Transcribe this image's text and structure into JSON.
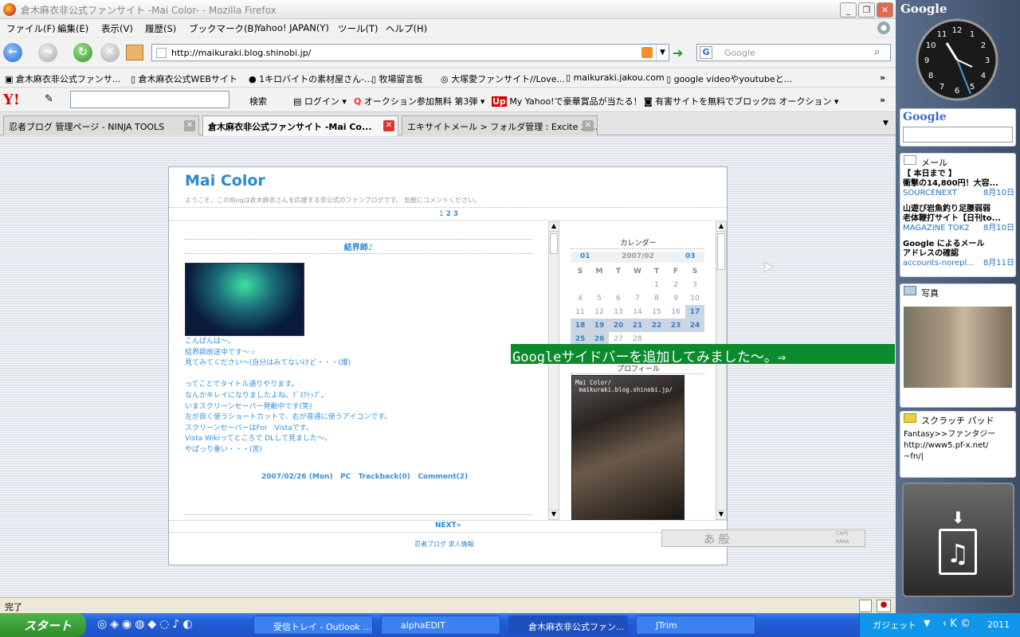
{
  "window": {
    "title": "倉木麻衣非公式ファンサイト -Mai Color- - Mozilla Firefox"
  },
  "menu": [
    "ファイル(F)",
    "編集(E)",
    "表示(V)",
    "履歴(S)",
    "ブックマーク(B)",
    "Yahoo! JAPAN(Y)",
    "ツール(T)",
    "ヘルプ(H)"
  ],
  "nav": {
    "url": "http://maikuraki.blog.shinobi.jp/",
    "search_placeholder": "Google"
  },
  "bookmarks": [
    "倉木麻衣非公式ファンサ...",
    "倉木麻衣公式WEBサイト",
    "1キロバイトの素材屋さん-...",
    "牧場留言板",
    "大塚愛ファンサイト//Love...",
    "maikuraki.jakou.com",
    "google videoやyoutubeと..."
  ],
  "yahoo_toolbar": {
    "search": "検索",
    "login": "ログイン",
    "items": [
      "オークション参加無料 第3弾",
      "My Yahoo!で豪華賞品が当たる！",
      "有害サイトを無料でブロック",
      "オークション"
    ]
  },
  "tabs": [
    {
      "label": "忍者ブログ 管理ページ - NINJA TOOLS",
      "active": false
    },
    {
      "label": "倉木麻衣非公式ファンサイト -Mai Co...",
      "active": true
    },
    {
      "label": "エキサイトメール > フォルダ管理 : Excite エ...",
      "active": false
    }
  ],
  "blog": {
    "title": "Mai Color",
    "desc": "ようこそ。このBlogは倉木麻衣さんを応援する非公式のファンブログです。 気軽にコメントください。",
    "pages": {
      "p1": "1",
      "p2": "2",
      "p3": "3"
    },
    "post_title": "結界師♪",
    "post_lines": [
      "こんばんは〜。",
      "結界師放送中です〜☆",
      "見てみてください〜(自分はみてないけど・・・(爆)",
      "",
      "ってことでタイトル通りやります。",
      "なんかキレイになりましたよね。ﾃﾞｽｸﾄｯﾌﾟ。",
      "いまスクリーンセーバー発動中です(笑)",
      "左が良く使うショートカットで、右が普通に使うアイコンです。",
      "スクリーンセーバーはFor　Vistaです。",
      "Vista Wikiってところで DLして見ました〜。",
      "やぱっり重い・・・(苦)"
    ],
    "post_meta": {
      "date": "2007/02/26 (Mon)",
      "cat": "PC",
      "trackback": "Trackback(0)",
      "comment": "Comment(2)"
    },
    "next": "NEXT»",
    "footer": "忍者ブログ 求人情報",
    "calendar": {
      "title": "カレンダー",
      "prev": "01",
      "month": "2007/02",
      "next": "03",
      "weekdays": [
        "S",
        "M",
        "T",
        "W",
        "T",
        "F",
        "S"
      ],
      "rows": [
        [
          "",
          "",
          "",
          "",
          "1",
          "2",
          "3"
        ],
        [
          "4",
          "5",
          "6",
          "7",
          "8",
          "9",
          "10"
        ],
        [
          "11",
          "12",
          "13",
          "14",
          "15",
          "16",
          "17"
        ],
        [
          "18",
          "19",
          "20",
          "21",
          "22",
          "23",
          "24"
        ],
        [
          "25",
          "26",
          "27",
          "28",
          "",
          "",
          ""
        ]
      ]
    },
    "profile_title": "プロフィール",
    "profile_caption": "Mai Color/\n maikuraki.blog.shinobi.jp/"
  },
  "overlay": "Googleサイドバーを追加してみました〜。⇒",
  "status": "完了",
  "ime": {
    "text": "あ 般",
    "caps": "CAPS",
    "kana": "KANA"
  },
  "sidebar": {
    "google_logo": "Google",
    "clock": [
      "12",
      "1",
      "2",
      "3",
      "4",
      "5",
      "6",
      "7",
      "8",
      "9",
      "10",
      "11"
    ],
    "mail_title": "メール",
    "mails": [
      {
        "subject": "【 本日まで 】\n衝撃の14,800円！大容...",
        "from": "SOURCENEXT",
        "date": "8月10日"
      },
      {
        "subject": "山遊び岩魚釣り足腰弱弱\n老体鞭打サイト【日刊to...",
        "from": "MAGAZINE TOK2",
        "date": "8月10日"
      },
      {
        "subject": "Google によるメール\nアドレスの確認",
        "from": "accounts-norepl...",
        "date": "8月11日"
      }
    ],
    "photo_title": "写真",
    "scratch_title": "スクラッチ パッド",
    "scratch_text": "Fantasy>>ファンタジー\nhttp://www5.pf-x.net/\n~fn/|"
  },
  "taskbar": {
    "start": "スタート",
    "tasks": [
      "受信トレイ - Outlook ...",
      "alphaEDIT",
      "倉木麻衣非公式ファン...",
      "JTrim"
    ],
    "gadget": "ガジェット",
    "clock": "2011"
  }
}
